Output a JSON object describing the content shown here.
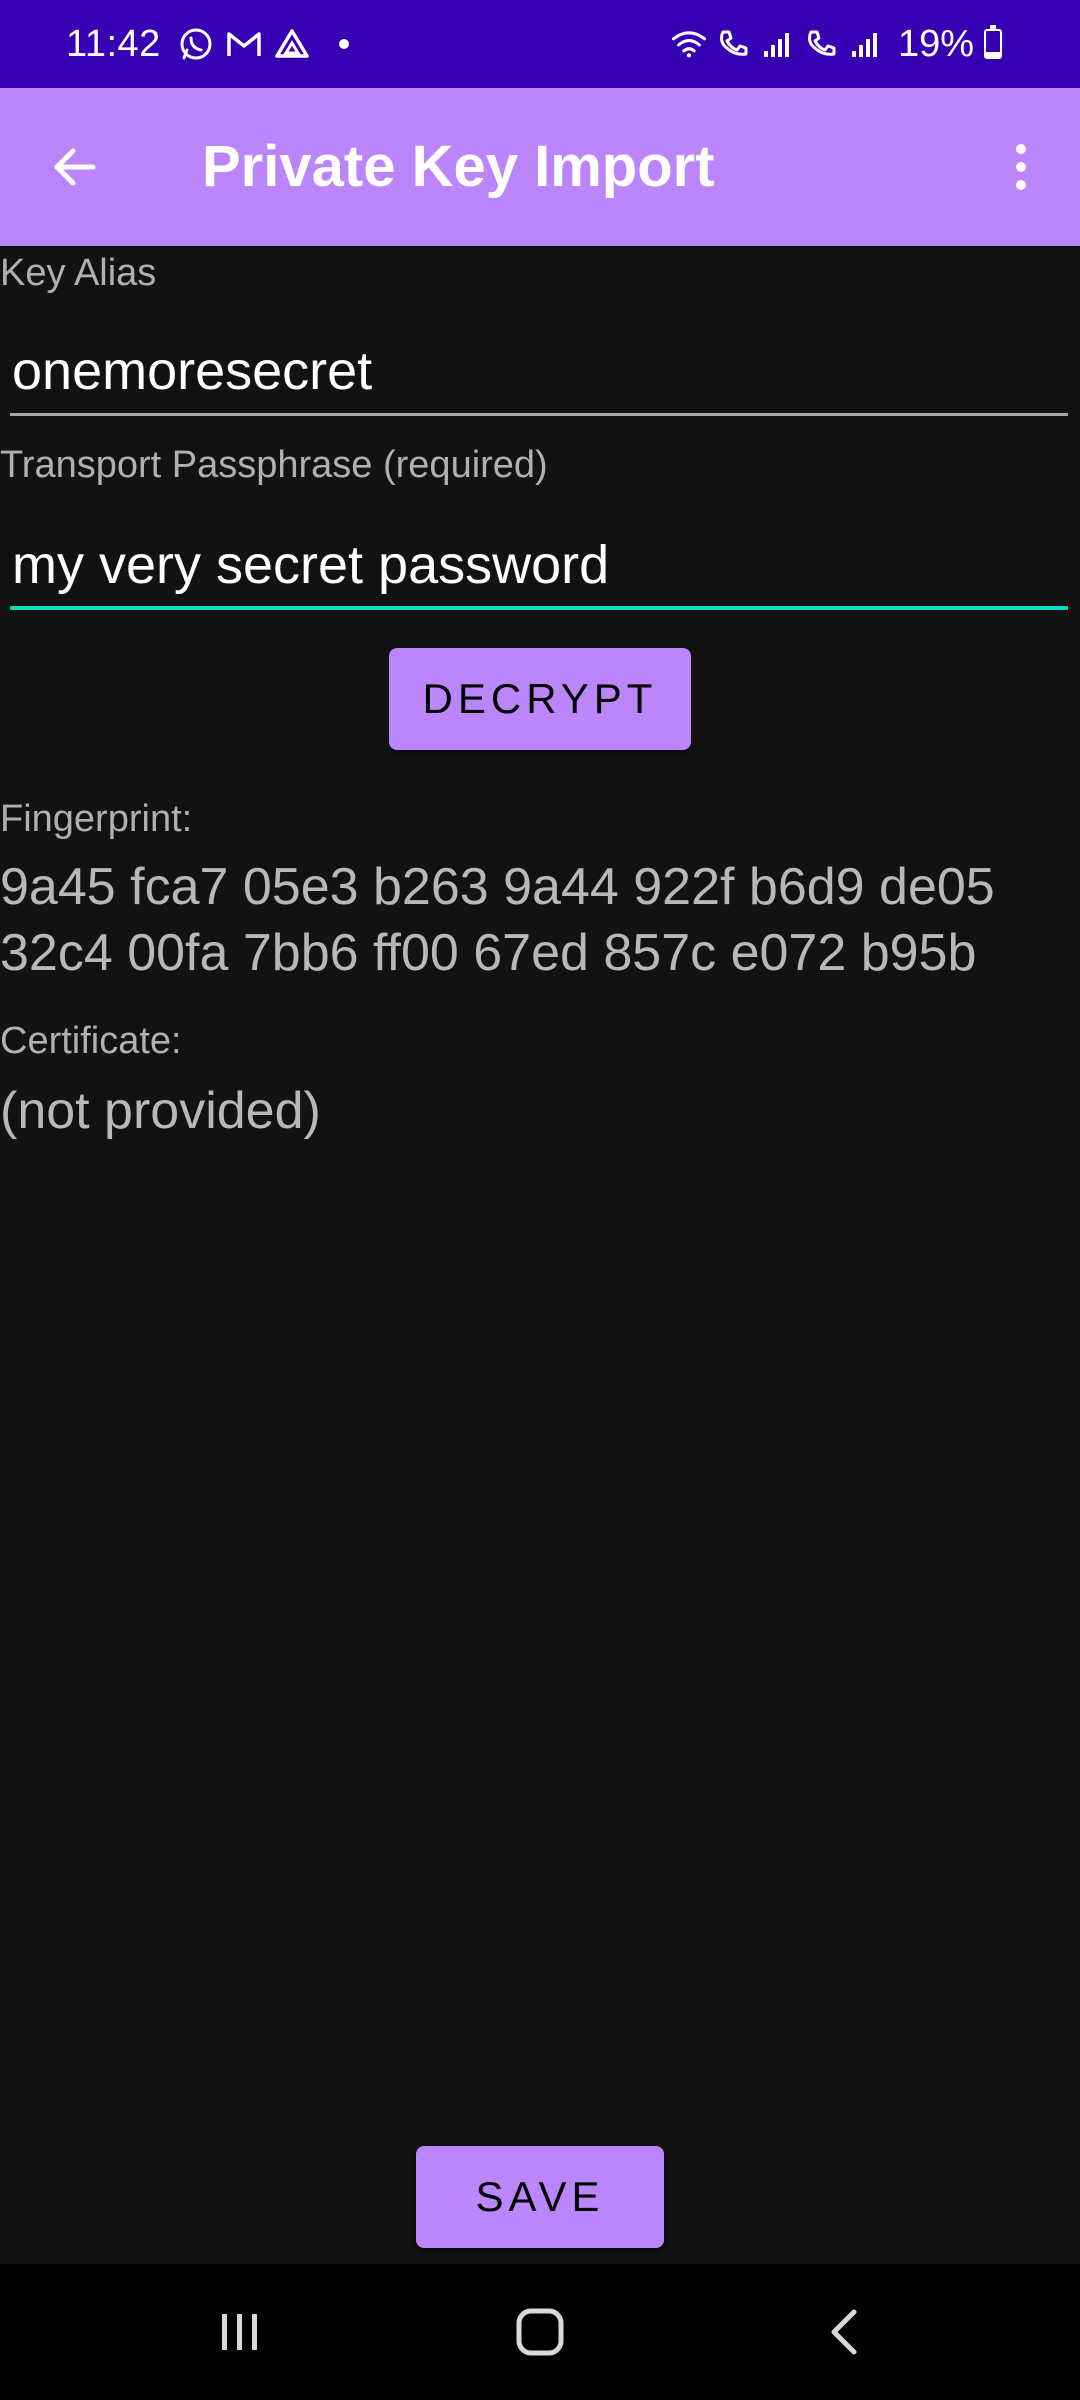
{
  "status_bar": {
    "time": "11:42",
    "notification_icons": [
      "whatsapp-icon",
      "gmail-icon",
      "drive-icon",
      "more-dot"
    ],
    "battery": "19%",
    "battery_level": 0.19
  },
  "app_bar": {
    "title": "Private Key Import"
  },
  "form": {
    "key_alias_label": "Key Alias",
    "key_alias_value": "onemoresecret",
    "passphrase_label": "Transport Passphrase (required)",
    "passphrase_value": "my very secret password",
    "decrypt_label": "DECRYPT"
  },
  "details": {
    "fingerprint_label": "Fingerprint:",
    "fingerprint_line1": "9a45 fca7 05e3 b263 9a44 922f b6d9 de05",
    "fingerprint_line2": "32c4 00fa 7bb6 ff00 67ed 857c e072 b95b",
    "certificate_label": "Certificate:",
    "certificate_value": "(not provided)"
  },
  "actions": {
    "save_label": "SAVE"
  },
  "colors": {
    "status_bar": "#3700b3",
    "app_bar": "#bb86fc",
    "background": "#121212",
    "focus_underline": "#03dac5",
    "button": "#bb86fc"
  }
}
